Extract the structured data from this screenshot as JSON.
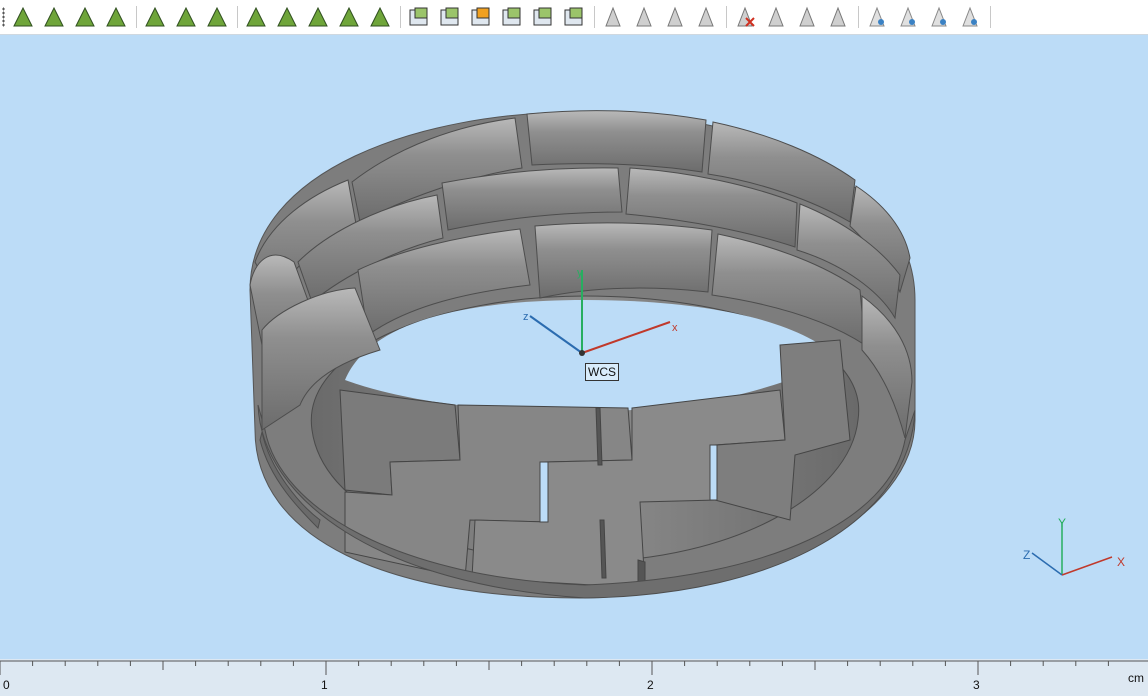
{
  "toolbar": {
    "groups": [
      [
        "select-vertex",
        "select-edge",
        "select-curve",
        "select-circle"
      ],
      [
        "select-face",
        "select-face-chain",
        "select-surface-curve"
      ],
      [
        "select-mesh",
        "select-mesh-chain",
        "select-mesh-radial",
        "select-mesh-wheel",
        "select-mesh-gear"
      ],
      [
        "select-solid",
        "select-body",
        "select-shaded-body",
        "select-wire-body",
        "select-body-hit",
        "select-assembly"
      ],
      [
        "filter-vertex",
        "filter-edge",
        "filter-faces",
        "filter-pick"
      ],
      [
        "filter-remove",
        "filter-mesh",
        "filter-sheet",
        "filter-surface"
      ],
      [
        "show-hide",
        "show-layers",
        "show-visible",
        "show-all"
      ]
    ]
  },
  "viewport": {
    "wcs_label": "WCS",
    "wcs_axes": {
      "x": "x",
      "y": "y",
      "z": "z"
    },
    "corner_axes": {
      "x": "X",
      "y": "Y",
      "z": "Z"
    },
    "colors": {
      "background": "#bcdcf7",
      "x_axis": "#c0392b",
      "y_axis": "#27ae60",
      "z_axis": "#2b6cb0",
      "model": "#7a7a7a"
    }
  },
  "ruler": {
    "unit": "cm",
    "labels": [
      "0",
      "1",
      "2",
      "3"
    ]
  }
}
